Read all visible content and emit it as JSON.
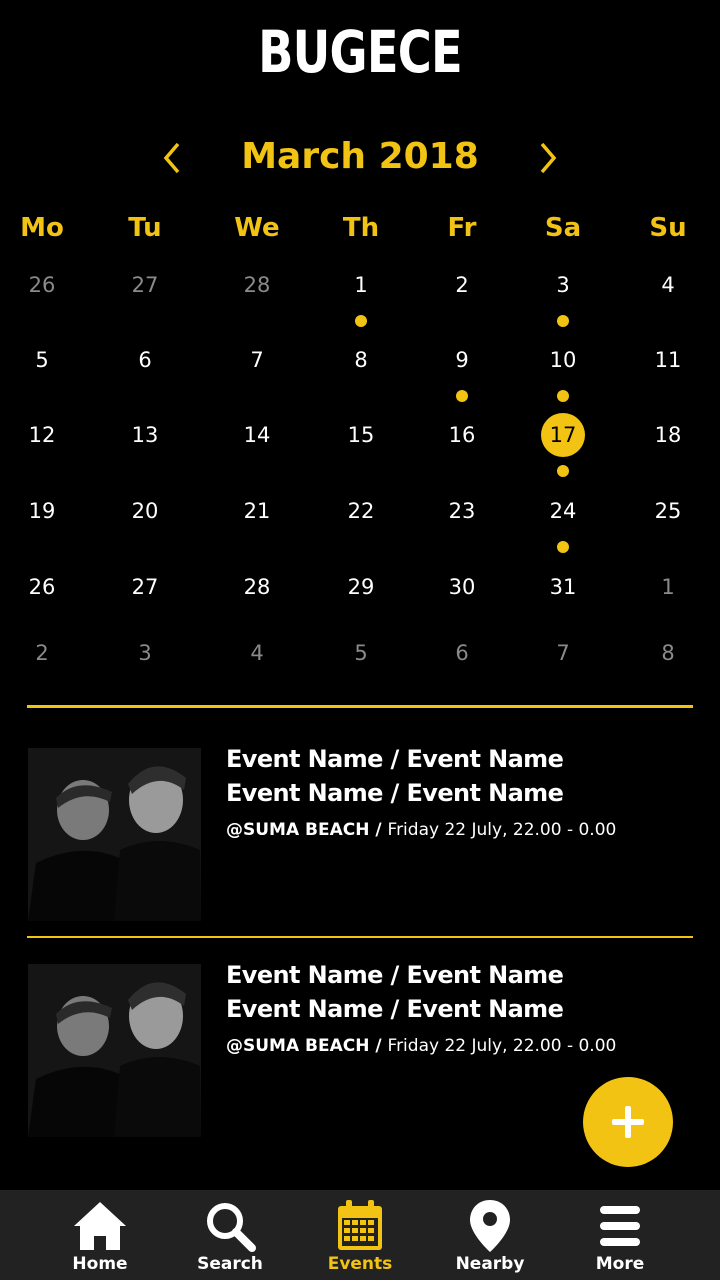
{
  "app": {
    "logo": "BUGECE"
  },
  "calendar": {
    "month_label": "March 2018",
    "weekdays": [
      "Mo",
      "Tu",
      "We",
      "Th",
      "Fr",
      "Sa",
      "Su"
    ],
    "weeks": [
      [
        {
          "d": "26",
          "muted": true
        },
        {
          "d": "27",
          "muted": true
        },
        {
          "d": "28",
          "muted": true
        },
        {
          "d": "1",
          "event": true
        },
        {
          "d": "2"
        },
        {
          "d": "3",
          "event": true
        },
        {
          "d": "4"
        }
      ],
      [
        {
          "d": "5"
        },
        {
          "d": "6"
        },
        {
          "d": "7"
        },
        {
          "d": "8"
        },
        {
          "d": "9",
          "event": true
        },
        {
          "d": "10",
          "event": true
        },
        {
          "d": "11"
        }
      ],
      [
        {
          "d": "12"
        },
        {
          "d": "13"
        },
        {
          "d": "14"
        },
        {
          "d": "15"
        },
        {
          "d": "16"
        },
        {
          "d": "17",
          "event": true,
          "selected": true
        },
        {
          "d": "18"
        }
      ],
      [
        {
          "d": "19"
        },
        {
          "d": "20"
        },
        {
          "d": "21"
        },
        {
          "d": "22"
        },
        {
          "d": "23"
        },
        {
          "d": "24",
          "event": true
        },
        {
          "d": "25"
        }
      ],
      [
        {
          "d": "26"
        },
        {
          "d": "27"
        },
        {
          "d": "28"
        },
        {
          "d": "29"
        },
        {
          "d": "30"
        },
        {
          "d": "31"
        },
        {
          "d": "1",
          "muted": true
        }
      ],
      [
        {
          "d": "2",
          "muted": true
        },
        {
          "d": "3",
          "muted": true
        },
        {
          "d": "4",
          "muted": true
        },
        {
          "d": "5",
          "muted": true
        },
        {
          "d": "6",
          "muted": true
        },
        {
          "d": "7",
          "muted": true
        },
        {
          "d": "8",
          "muted": true
        }
      ]
    ]
  },
  "events": [
    {
      "title_line1": "Event Name / Event Name",
      "title_line2": "Event Name / Event Name",
      "venue": "@SUMA BEACH",
      "separator": " / ",
      "datetime": "Friday 22 July, 22.00 - 0.00"
    },
    {
      "title_line1": "Event Name / Event Name",
      "title_line2": "Event Name / Event Name",
      "venue": "@SUMA BEACH",
      "separator": " / ",
      "datetime": "Friday 22 July, 22.00 - 0.00"
    }
  ],
  "tabs": [
    {
      "label": "Home",
      "icon": "home-icon"
    },
    {
      "label": "Search",
      "icon": "search-icon"
    },
    {
      "label": "Events",
      "icon": "calendar-icon",
      "active": true
    },
    {
      "label": "Nearby",
      "icon": "location-pin-icon"
    },
    {
      "label": "More",
      "icon": "menu-icon"
    }
  ],
  "colors": {
    "accent": "#f2c313",
    "background": "#000000",
    "tabbar": "#222222",
    "muted": "#8a8a8a"
  }
}
